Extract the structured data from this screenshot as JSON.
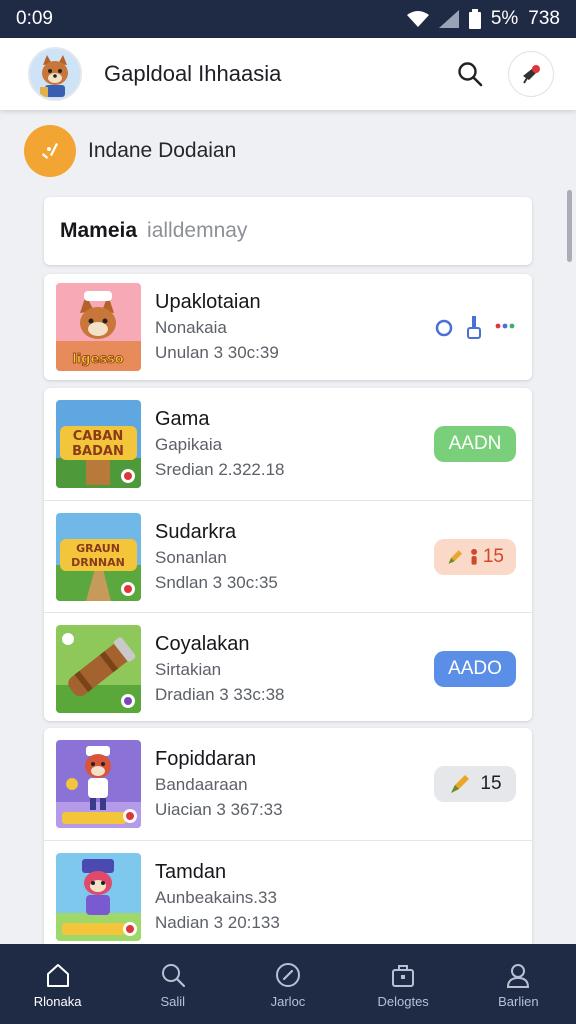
{
  "status_bar": {
    "time": "0:09",
    "battery": "5%",
    "clock_right": "738"
  },
  "header": {
    "title": "Gapldoal Ihhaasia",
    "avatar_icon": "fox-avatar-icon"
  },
  "section": {
    "title": "Indane Dodaian"
  },
  "search": {
    "label": "Mameia",
    "placeholder": "ialldemnay"
  },
  "list": [
    {
      "title": "Upaklotaian",
      "subtitle": "Nonakaia",
      "meta": "Unulan 3 30c:39",
      "badge_text": "",
      "badge_type": "tools",
      "thumb_text": "ligesso"
    },
    {
      "title": "Gama",
      "subtitle": "Gapikaia",
      "meta": "Sredian 2.322.18",
      "badge_text": "AADN",
      "badge_type": "green",
      "thumb_text": "CABAN BADAN"
    },
    {
      "title": "Sudarkra",
      "subtitle": "Sonanlan",
      "meta": "Sndlan 3 30c:35",
      "badge_text": "15",
      "badge_type": "peach",
      "thumb_text": "GRAUN DRNNAN"
    },
    {
      "title": "Coyalakan",
      "subtitle": "Sirtakian",
      "meta": "Dradian 3 33c:38",
      "badge_text": "AADO",
      "badge_type": "blue",
      "thumb_text": ""
    },
    {
      "title": "Fopiddaran",
      "subtitle": "Bandaaraan",
      "meta": "Uiacian 3 367:33",
      "badge_text": "15",
      "badge_type": "grey",
      "thumb_text": ""
    },
    {
      "title": "Tamdan",
      "subtitle": "Aunbeakains.33",
      "meta": "Nadian 3 20:133",
      "badge_text": "",
      "badge_type": "none",
      "thumb_text": ""
    }
  ],
  "bottom_nav": [
    {
      "label": "Rlonaka",
      "icon": "home-icon"
    },
    {
      "label": "Salil",
      "icon": "search-icon"
    },
    {
      "label": "Jarloc",
      "icon": "compass-icon"
    },
    {
      "label": "Delogtes",
      "icon": "bag-icon"
    },
    {
      "label": "Barlien",
      "icon": "profile-icon"
    }
  ],
  "colors": {
    "nav_bg": "#1f2a44",
    "accent_orange": "#f2a533",
    "green": "#7ad07a",
    "blue": "#5b8ee6",
    "peach": "#fbd9c8"
  }
}
